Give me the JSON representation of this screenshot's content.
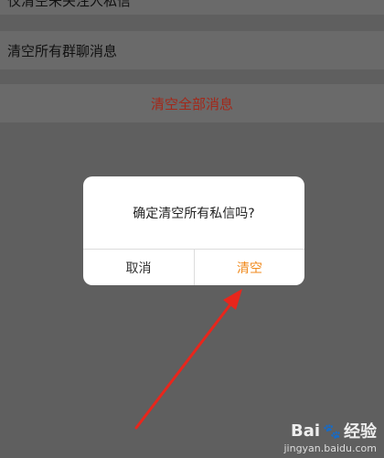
{
  "list": {
    "top_item": "仅清空未关注人私信",
    "group_item": "清空所有群聊消息",
    "clear_all": "清空全部消息"
  },
  "dialog": {
    "message": "确定清空所有私信吗?",
    "cancel_label": "取消",
    "confirm_label": "清空"
  },
  "watermark": {
    "brand_left": "Bai",
    "brand_right": "经验",
    "url": "jingyan.baidu.com"
  },
  "colors": {
    "overlay": "#5f5f5f",
    "accent_orange": "#f08a1d",
    "danger_red": "#a3281a",
    "arrow_red": "#e8261c"
  }
}
